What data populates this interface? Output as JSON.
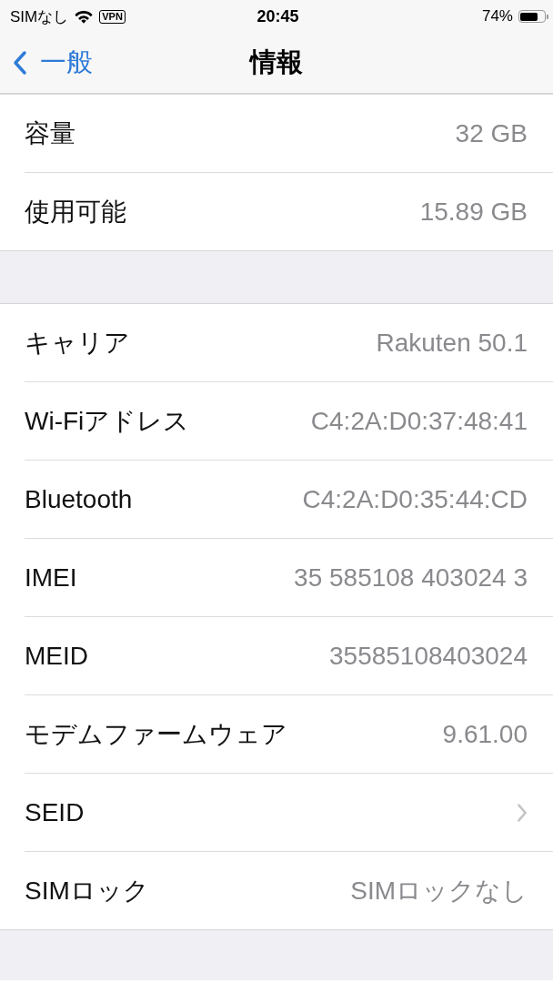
{
  "status_bar": {
    "carrier": "SIMなし",
    "vpn": "VPN",
    "time": "20:45",
    "battery": "74%"
  },
  "nav": {
    "back": "一般",
    "title": "情報"
  },
  "groups": [
    {
      "rows": [
        {
          "kind": "value",
          "label": "容量",
          "value": "32 GB"
        },
        {
          "kind": "value",
          "label": "使用可能",
          "value": "15.89 GB"
        }
      ]
    },
    {
      "rows": [
        {
          "kind": "value",
          "label": "キャリア",
          "value": "Rakuten 50.1"
        },
        {
          "kind": "value",
          "label": "Wi-Fiアドレス",
          "value": "C4:2A:D0:37:48:41"
        },
        {
          "kind": "value",
          "label": "Bluetooth",
          "value": "C4:2A:D0:35:44:CD"
        },
        {
          "kind": "value",
          "label": "IMEI",
          "value": "35 585108 403024 3"
        },
        {
          "kind": "value",
          "label": "MEID",
          "value": "35585108403024"
        },
        {
          "kind": "value",
          "label": "モデムファームウェア",
          "value": "9.61.00"
        },
        {
          "kind": "link",
          "label": "SEID"
        },
        {
          "kind": "value",
          "label": "SIMロック",
          "value": "SIMロックなし"
        }
      ]
    }
  ]
}
